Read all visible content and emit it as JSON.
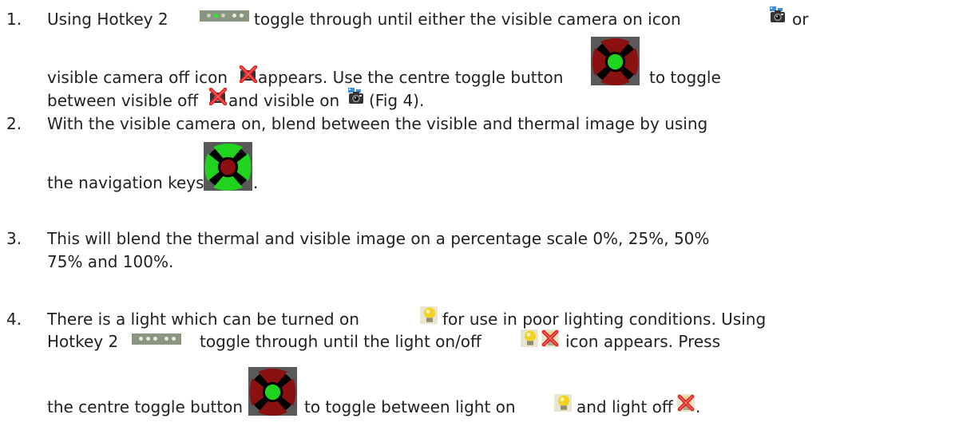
{
  "steps": [
    {
      "num": "1.",
      "a": "Using Hotkey 2",
      "b": "toggle through until either the visible camera on icon",
      "c": "or",
      "d": "visible camera off icon",
      "e": "appears.  Use the centre toggle button",
      "f": "to toggle",
      "g": "between visible off",
      "h": "and visible on",
      "i": "(Fig 4)."
    },
    {
      "num": "2.",
      "a": "With the visible camera on, blend between the visible and thermal image by using",
      "b": "the navigation keys",
      "c": "."
    },
    {
      "num": "3.",
      "a": "This will blend the thermal and visible image on a percentage scale 0%, 25%, 50%",
      "b": "75% and 100%."
    },
    {
      "num": "4.",
      "a": "There is a light which can be turned on",
      "b": "for use in poor lighting conditions.  Using",
      "c": "Hotkey 2",
      "d": "toggle through until the light on/off",
      "e": "icon appears.  Press",
      "f": "the centre toggle button",
      "g": "to toggle between light on",
      "h": "and light off",
      "i": "."
    }
  ],
  "icons": {
    "hotkey": "hotkey-2-icon",
    "camera_on": "visible-camera-on-icon",
    "camera_off": "visible-camera-off-icon",
    "nav_center": "centre-toggle-button-icon",
    "nav_arrows": "navigation-keys-icon",
    "light_on": "light-on-icon",
    "light_off": "light-off-icon"
  },
  "colors": {
    "text": "#222222",
    "hotkey_bg": "#8a9680",
    "nav_bg": "#595959",
    "nav_green": "#1fd31f",
    "nav_red": "#8b1111"
  }
}
